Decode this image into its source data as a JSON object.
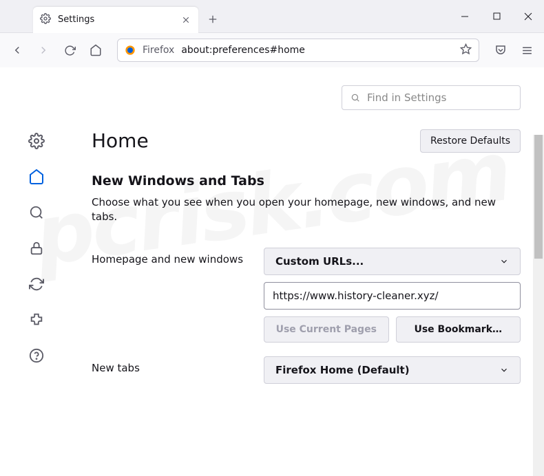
{
  "tab": {
    "title": "Settings"
  },
  "urlbar": {
    "prefix": "Firefox",
    "path": "about:preferences#home"
  },
  "search": {
    "placeholder": "Find in Settings"
  },
  "page": {
    "title": "Home",
    "restore": "Restore Defaults",
    "section_heading": "New Windows and Tabs",
    "section_desc": "Choose what you see when you open your homepage, new windows, and new tabs."
  },
  "homepage": {
    "label": "Homepage and new windows",
    "select_value": "Custom URLs...",
    "url_value": "https://www.history-cleaner.xyz/",
    "use_current": "Use Current Pages",
    "use_bookmark": "Use Bookmark…"
  },
  "newtabs": {
    "label": "New tabs",
    "select_value": "Firefox Home (Default)"
  },
  "watermark": "pcrisk.com"
}
